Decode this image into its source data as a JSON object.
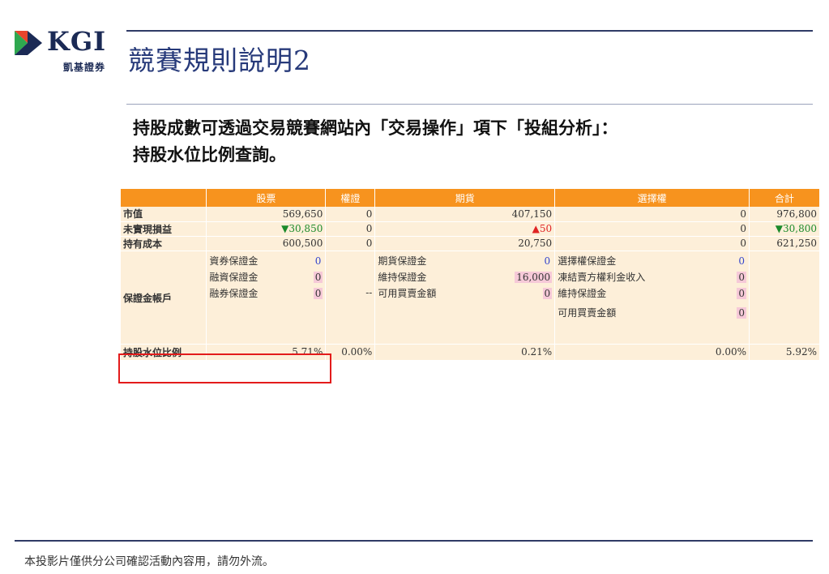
{
  "logo": {
    "brand": "KGI",
    "sub": "凱基證券"
  },
  "title": "競賽規則說明2",
  "intro": [
    "持股成數可透過交易競賽網站內「交易操作」項下「投組分析」：",
    "持股水位比例查詢。"
  ],
  "table": {
    "headers": [
      "",
      "股票",
      "權證",
      "期貨",
      "選擇權",
      "合計"
    ],
    "rows": {
      "market_value": {
        "label": "市值",
        "stock": "569,650",
        "warrant": "0",
        "futures": "407,150",
        "options": "0",
        "total": "976,800"
      },
      "unrealized": {
        "label": "未實現損益",
        "stock": "30,850",
        "warrant": "0",
        "futures": "50",
        "options": "0",
        "total": "30,800"
      },
      "cost": {
        "label": "持有成本",
        "stock": "600,500",
        "warrant": "0",
        "futures": "20,750",
        "options": "0",
        "total": "621,250"
      }
    },
    "margin": {
      "label": "保證金帳戶",
      "stock": [
        {
          "name": "資券保證金",
          "value": "0"
        },
        {
          "name": "融資保證金",
          "value": "0"
        },
        {
          "name": "融券保證金",
          "value": "0"
        }
      ],
      "warrant_dash": "--",
      "futures": [
        {
          "name": "期貨保證金",
          "value": "0"
        },
        {
          "name": "維持保證金",
          "value": "16,000"
        },
        {
          "name": "可用買賣金額",
          "value": "0"
        }
      ],
      "options": [
        {
          "name": "選擇權保證金",
          "value": "0"
        },
        {
          "name": "凍結賣方權利金收入",
          "value": "0"
        },
        {
          "name": "維持保證金",
          "value": "0"
        },
        {
          "name": "可用買賣金額",
          "value": "0"
        }
      ]
    },
    "ratio": {
      "label": "持股水位比例",
      "stock": "5.71%",
      "warrant": "0.00%",
      "futures": "0.21%",
      "options": "0.00%",
      "total": "5.92%"
    }
  },
  "footer": "本投影片僅供分公司確認活動內容用，請勿外流。",
  "colors": {
    "header_bg": "#f7931e",
    "cell_bg": "#fdefd9",
    "down": "#1b8a2a",
    "up": "#e02424",
    "highlight": "#e31b1b",
    "title": "#273a7a"
  }
}
